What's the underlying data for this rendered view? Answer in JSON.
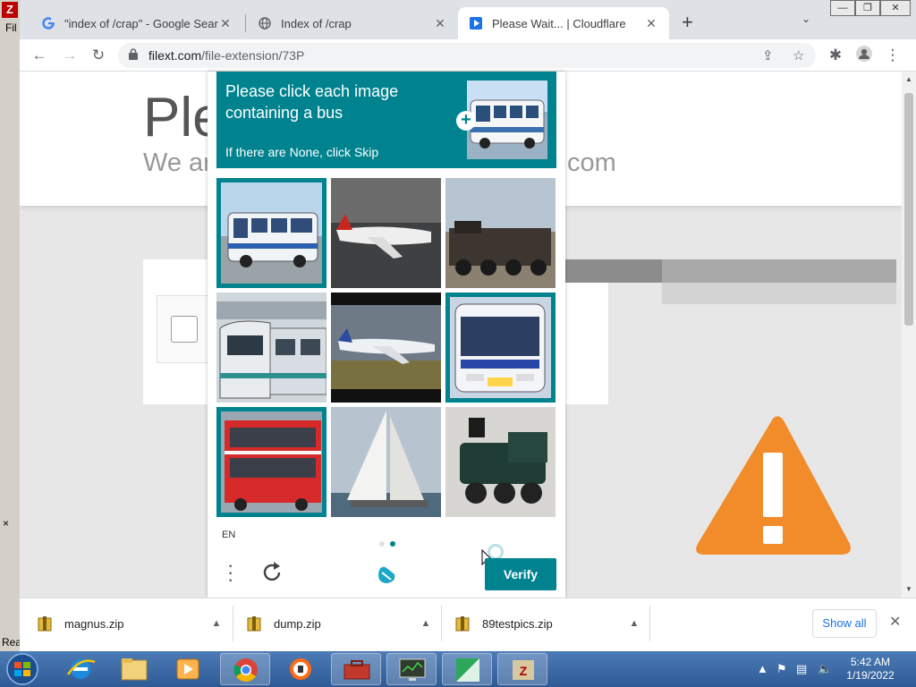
{
  "bg_app": {
    "menu_fragment": "Fil",
    "status_fragment": "Rea"
  },
  "tabs": [
    {
      "title": "\"index of /crap\" - Google Search",
      "favicon": "google-icon"
    },
    {
      "title": "Index of /crap",
      "favicon": "globe-icon"
    },
    {
      "title": "Please Wait... | Cloudflare",
      "favicon": "cloudflare-icon",
      "active": true
    }
  ],
  "address_bar": {
    "domain": "filext.com",
    "path": "/file-extension/73P"
  },
  "page": {
    "heading": "Ple",
    "subheading_left": "We ar",
    "subheading_right": "com"
  },
  "captcha": {
    "prompt": "Please click each image containing a bus",
    "skip_hint": "If there are None, click Skip",
    "language": "EN",
    "verify_label": "Verify",
    "accent_color": "#00838f",
    "tiles": [
      {
        "subject": "bus",
        "selected": true
      },
      {
        "subject": "airplane",
        "selected": false
      },
      {
        "subject": "locomotive",
        "selected": false
      },
      {
        "subject": "tram",
        "selected": false
      },
      {
        "subject": "airplane",
        "selected": false
      },
      {
        "subject": "bus",
        "selected": true
      },
      {
        "subject": "double-decker bus",
        "selected": true
      },
      {
        "subject": "sailboat",
        "selected": false
      },
      {
        "subject": "steam locomotive",
        "selected": false
      }
    ]
  },
  "downloads": {
    "items": [
      {
        "name": "magnus.zip"
      },
      {
        "name": "dump.zip"
      },
      {
        "name": "89testpics.zip"
      }
    ],
    "show_all_label": "Show all"
  },
  "taskbar": {
    "time": "5:42 AM",
    "date": "1/19/2022"
  }
}
